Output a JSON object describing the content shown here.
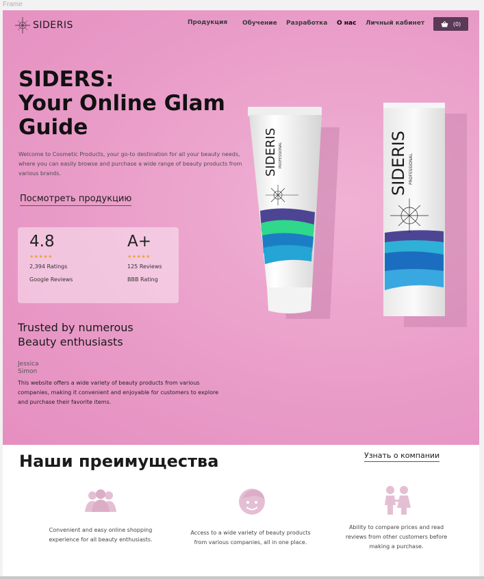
{
  "frame_label": "Frame",
  "brand": {
    "logo_text": "SIDERIS",
    "logo_icon": "compass-star-icon"
  },
  "nav": {
    "items": [
      {
        "label": "Продукция",
        "active": false
      },
      {
        "label": "Обучение",
        "active": false
      },
      {
        "label": "Разработка",
        "active": false
      },
      {
        "label": "О нас",
        "active": true
      },
      {
        "label": "Личный кабинет",
        "active": false
      }
    ],
    "cart": {
      "icon": "basket-icon",
      "count_label": "(0)"
    }
  },
  "hero": {
    "title_line1": "SIDERS:",
    "title_line2": "Your Online Glam",
    "title_line3": "Guide",
    "intro": "Welcome to Cosmetic Products, your go-to destination for all your beauty needs, where you can easily browse and purchase a wide range of beauty products from various brands.",
    "cta": "Посмотреть продукцию",
    "background_color": "#e99cc8"
  },
  "ratings": {
    "google": {
      "score": "4.8",
      "stars": "★★★★★",
      "count": "2,394 Ratings",
      "source": "Google Reviews"
    },
    "bbb": {
      "score": "A+",
      "stars": "★★★★★",
      "count": "125 Reviews",
      "source": "BBB Rating"
    },
    "star_color": "#e8a33a"
  },
  "testimonial": {
    "heading_line1": "Trusted by numerous",
    "heading_line2": "Beauty enthusiasts",
    "author_first": "Jessica",
    "author_last": "Simon",
    "text": "This website offers a wide variety of beauty products from various companies, making it convenient and enjoyable for customers to explore and purchase their favorite items."
  },
  "products": {
    "tube_brand": "SIDERIS",
    "tube_sub": "PROFESSIONAL",
    "box_brand": "SIDERIS",
    "box_sub": "PROFESSIONAL"
  },
  "advantages": {
    "title": "Наши преимущества",
    "about_link": "Узнать о компании",
    "icon_color": "#e4bfd3",
    "items": [
      {
        "icon": "users-icon",
        "text": "Convenient and easy online shopping experience for all beauty enthusiasts."
      },
      {
        "icon": "smiling-face-icon",
        "text": "Access to a wide variety of beauty products from various companies, all in one place."
      },
      {
        "icon": "children-icon",
        "text": "Ability to compare prices and read reviews from other customers before making a purchase."
      }
    ]
  }
}
